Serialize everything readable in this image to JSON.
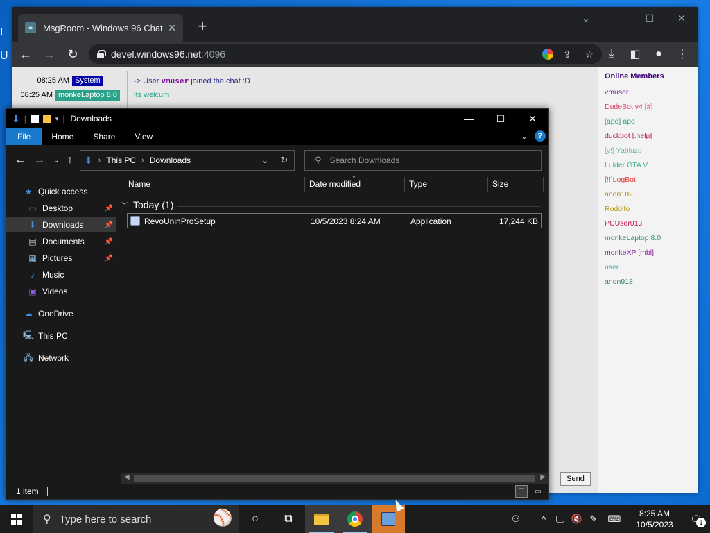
{
  "desktop": {
    "edge_text_1": "I",
    "edge_text_2": "U"
  },
  "chrome": {
    "tab_title": "MsgRoom - Windows 96 Chat",
    "tab_close": "✕",
    "new_tab": "+",
    "url_host": "devel.windows96.net",
    "url_port": ":4096"
  },
  "chat": {
    "messages": [
      {
        "time": "08:25 AM",
        "nick": "System",
        "text_pre": "-> User ",
        "text_user": "vmuser",
        "text_post": " joined the chat :D"
      },
      {
        "time": "08:25 AM",
        "nick": "monkeLaptop 8.0",
        "text": "its welcum"
      }
    ],
    "send_label": "Send"
  },
  "members": {
    "title": "Online Members",
    "list": [
      {
        "name": "vmuser",
        "color": "#7a1fa2"
      },
      {
        "name": "DudeBot v4 [#]",
        "color": "#e0406a"
      },
      {
        "name": "[apd] apd",
        "color": "#2aa38a"
      },
      {
        "name": "duckbot [.help]",
        "color": "#c2185b"
      },
      {
        "name": "[y!] Yabluzo",
        "color": "#5fbf8f"
      },
      {
        "name": "Lulder GTA V",
        "color": "#3fb08f"
      },
      {
        "name": "[!!]LogBot",
        "color": "#e53935"
      },
      {
        "name": "anon182",
        "color": "#b8860b"
      },
      {
        "name": "Rodolfo",
        "color": "#b8960b"
      },
      {
        "name": "PCUser013",
        "color": "#c2185b"
      },
      {
        "name": "monkeLaptop 8.0",
        "color": "#2a8f7a"
      },
      {
        "name": "monkeXP [mbl]",
        "color": "#8e24aa"
      },
      {
        "name": "user",
        "color": "#3fa8b0"
      },
      {
        "name": "anon918",
        "color": "#2a8f5a"
      }
    ]
  },
  "explorer": {
    "title": "Downloads",
    "ribbon": {
      "file": "File",
      "home": "Home",
      "share": "Share",
      "view": "View"
    },
    "breadcrumb": [
      "This PC",
      "Downloads"
    ],
    "search_placeholder": "Search Downloads",
    "nav": {
      "quick_access": "Quick access",
      "desktop": "Desktop",
      "downloads": "Downloads",
      "documents": "Documents",
      "pictures": "Pictures",
      "music": "Music",
      "videos": "Videos",
      "onedrive": "OneDrive",
      "this_pc": "This PC",
      "network": "Network"
    },
    "columns": {
      "name": "Name",
      "date": "Date modified",
      "type": "Type",
      "size": "Size"
    },
    "group": "Today (1)",
    "files": [
      {
        "name": "RevoUninProSetup",
        "date": "10/5/2023 8:24 AM",
        "type": "Application",
        "size": "17,244 KB"
      }
    ],
    "status": "1 item"
  },
  "taskbar": {
    "search_placeholder": "Type here to search",
    "time": "8:25 AM",
    "date": "10/5/2023",
    "notifications": "1"
  }
}
